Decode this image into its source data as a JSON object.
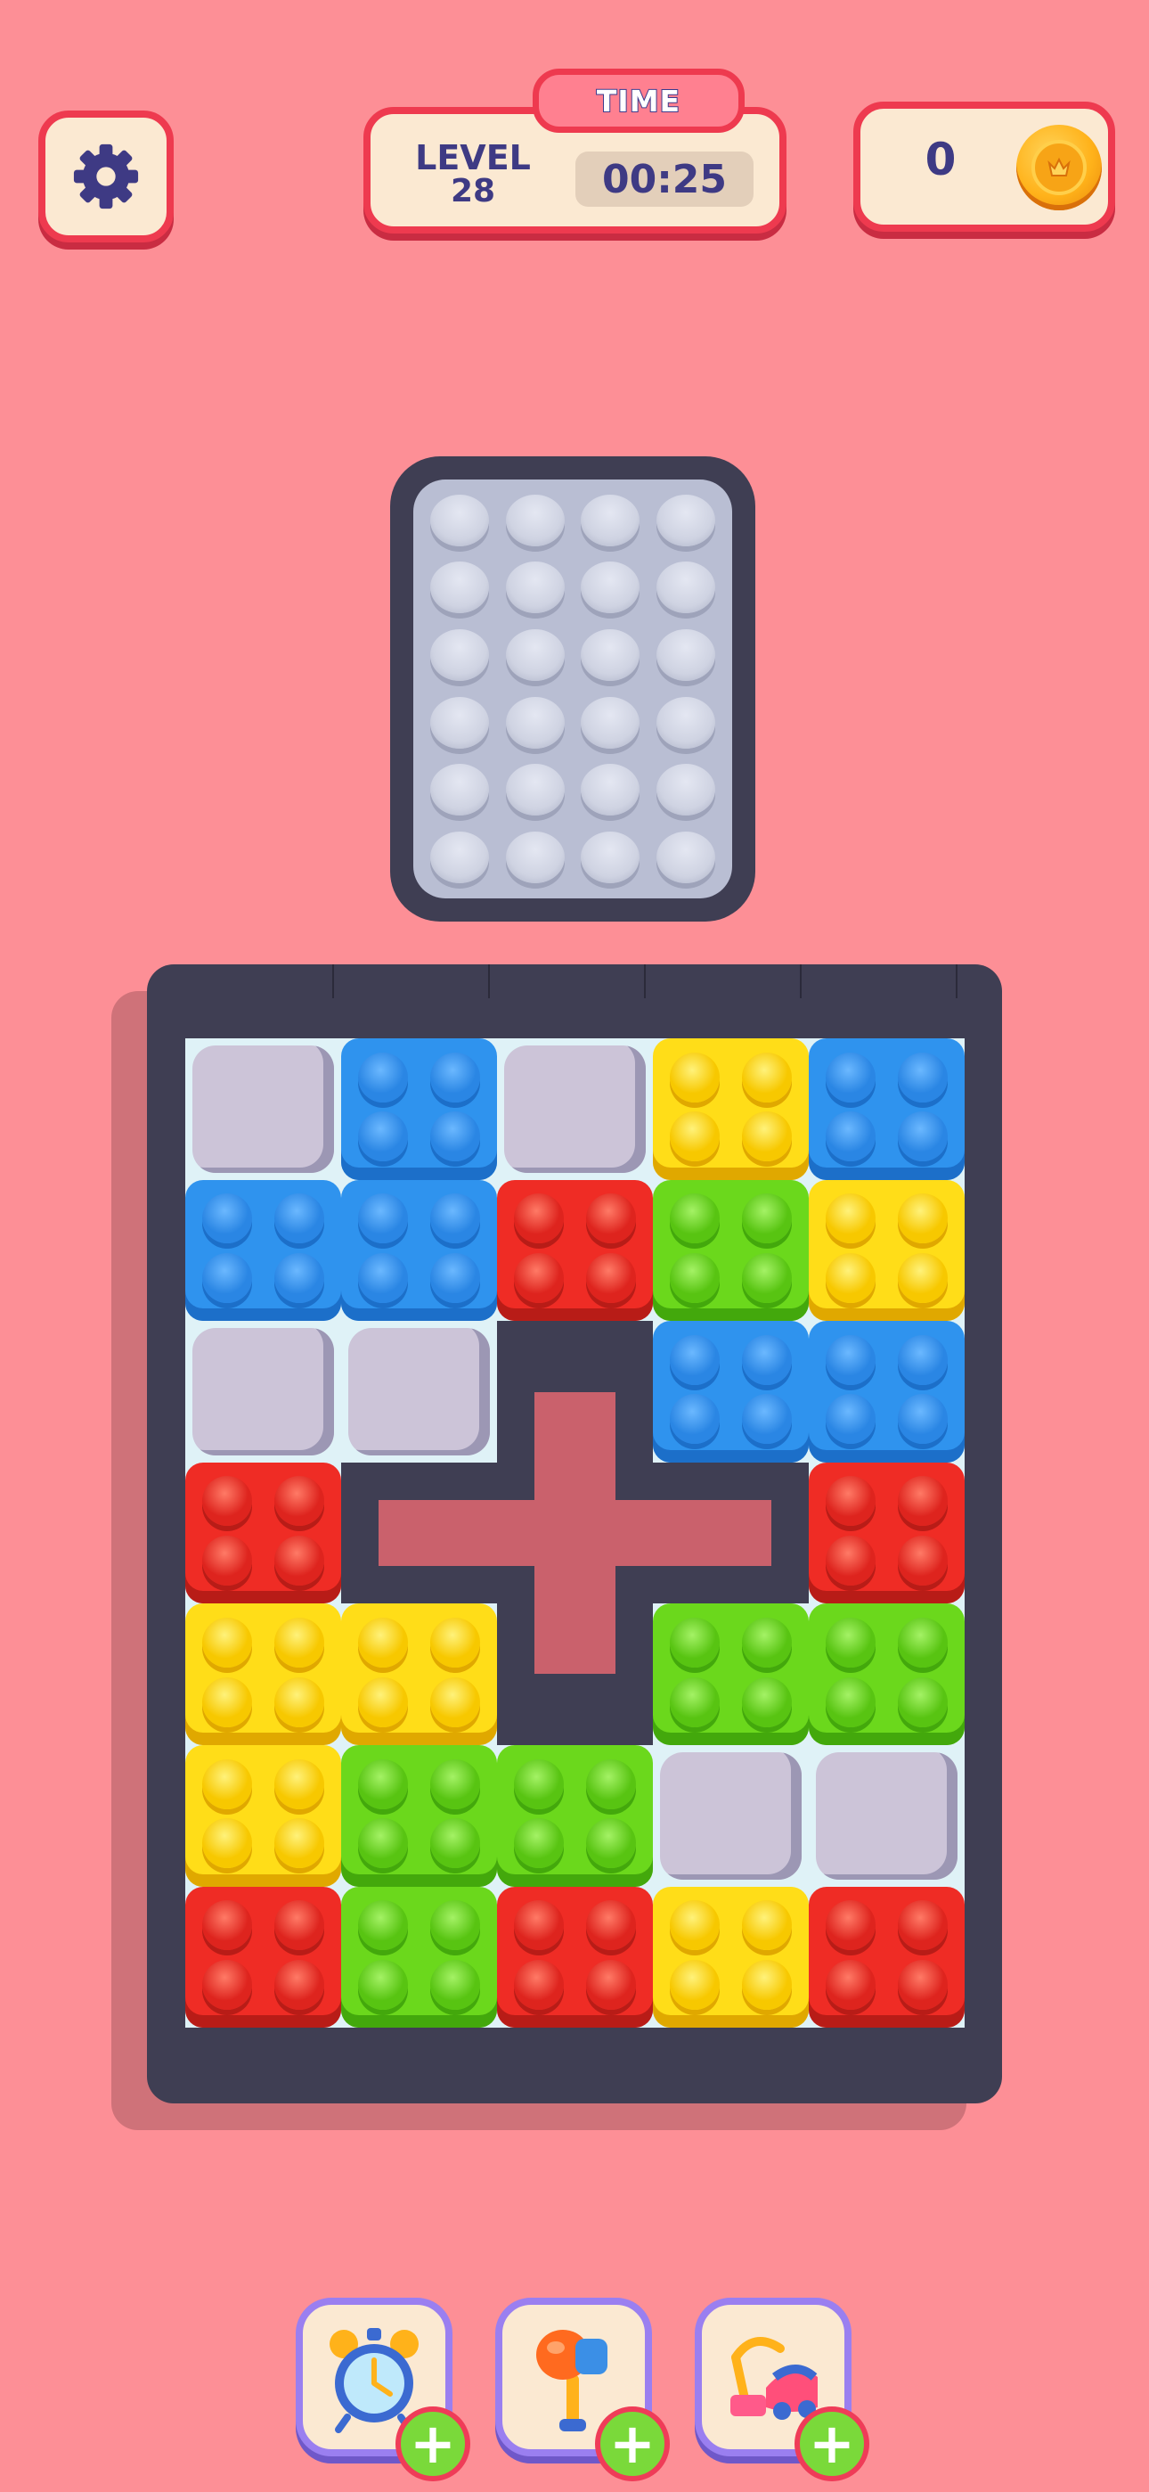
{
  "hud": {
    "time_label": "TIME",
    "level_label": "LEVEL",
    "level_number": "28",
    "timer": "00:25",
    "coins": "0"
  },
  "colors": {
    "blue": "#2f93ee",
    "yellow": "#ffdd18",
    "green": "#6bd81c",
    "red": "#ef2c25",
    "empty": "#ccc4d8",
    "frame": "#3f3e53",
    "background": "#fd8f96"
  },
  "tray": {
    "rows": 6,
    "cols": 4,
    "filled": 0
  },
  "board": {
    "rows": 7,
    "cols": 5,
    "bricks": [
      {
        "color": "blue",
        "cells": [
          [
            0,
            1
          ],
          [
            1,
            0
          ],
          [
            1,
            1
          ]
        ]
      },
      {
        "color": "yellow",
        "cells": [
          [
            0,
            3
          ]
        ]
      },
      {
        "color": "blue",
        "cells": [
          [
            0,
            4
          ]
        ]
      },
      {
        "color": "red",
        "cells": [
          [
            1,
            2
          ]
        ]
      },
      {
        "color": "green",
        "cells": [
          [
            1,
            3
          ]
        ]
      },
      {
        "color": "yellow",
        "cells": [
          [
            1,
            4
          ]
        ]
      },
      {
        "color": "blue",
        "cells": [
          [
            2,
            3
          ],
          [
            2,
            4
          ]
        ]
      },
      {
        "color": "red",
        "cells": [
          [
            3,
            0
          ]
        ]
      },
      {
        "color": "red",
        "cells": [
          [
            3,
            4
          ]
        ]
      },
      {
        "color": "yellow",
        "cells": [
          [
            4,
            0
          ],
          [
            4,
            1
          ],
          [
            5,
            0
          ]
        ]
      },
      {
        "color": "green",
        "cells": [
          [
            4,
            3
          ]
        ]
      },
      {
        "color": "green",
        "cells": [
          [
            4,
            4
          ]
        ]
      },
      {
        "color": "green",
        "cells": [
          [
            5,
            1
          ],
          [
            5,
            2
          ],
          [
            6,
            1
          ]
        ]
      },
      {
        "color": "red",
        "cells": [
          [
            6,
            0
          ]
        ]
      },
      {
        "color": "red",
        "cells": [
          [
            6,
            2
          ]
        ]
      },
      {
        "color": "yellow",
        "cells": [
          [
            6,
            3
          ]
        ]
      },
      {
        "color": "red",
        "cells": [
          [
            6,
            4
          ]
        ]
      }
    ],
    "empty": [
      [
        0,
        0
      ],
      [
        0,
        2
      ],
      [
        2,
        0
      ],
      [
        2,
        1
      ],
      [
        5,
        3
      ],
      [
        5,
        4
      ]
    ],
    "cross_cells": [
      [
        2,
        2
      ],
      [
        3,
        1
      ],
      [
        3,
        2
      ],
      [
        3,
        3
      ],
      [
        4,
        2
      ]
    ]
  },
  "boosters": [
    {
      "name": "alarm-clock-booster"
    },
    {
      "name": "hammer-booster"
    },
    {
      "name": "vacuum-booster"
    }
  ]
}
